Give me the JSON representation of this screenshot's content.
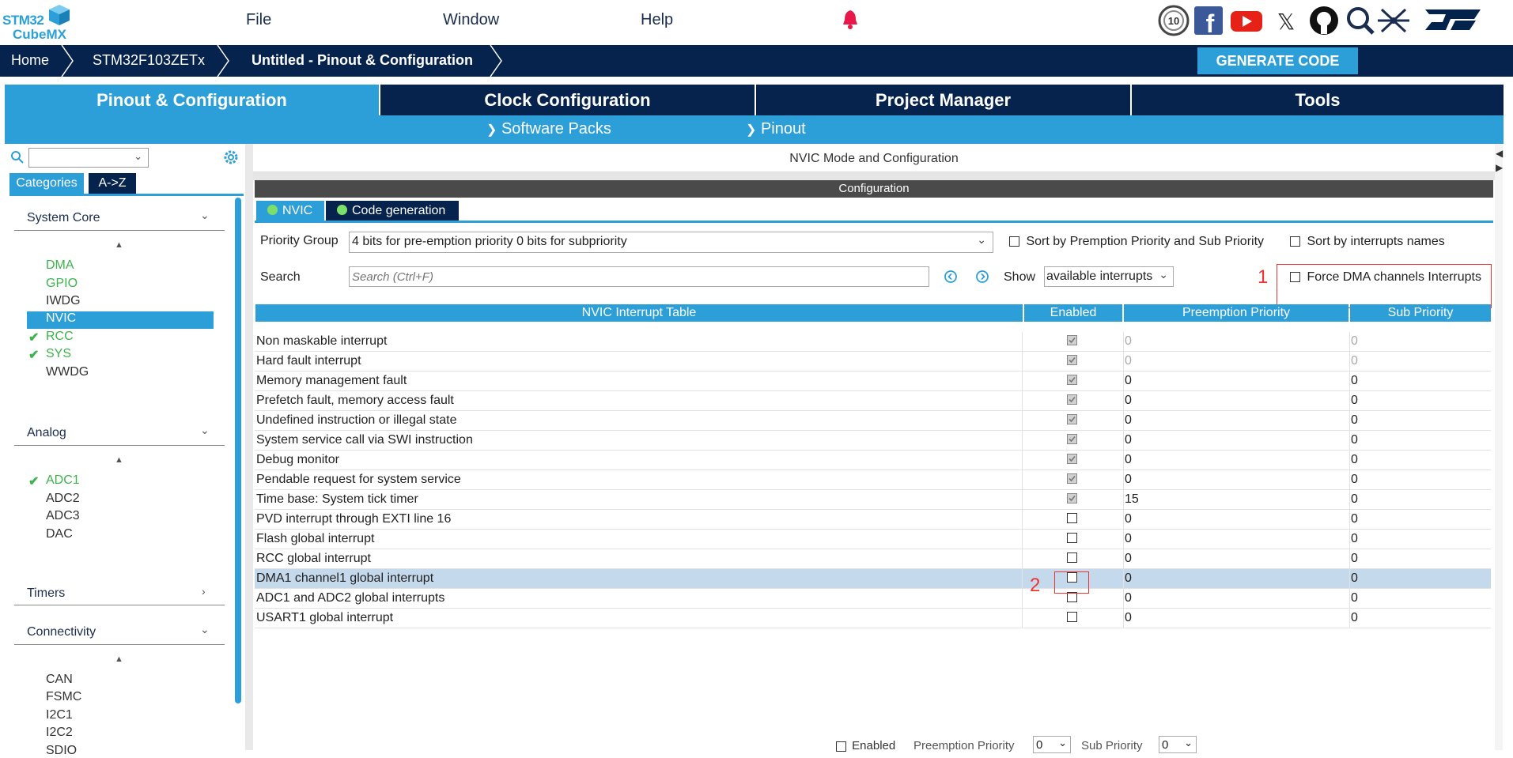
{
  "app": {
    "logo_top": "STM32",
    "logo_bottom": "CubeMX"
  },
  "menu": [
    "File",
    "Window",
    "Help"
  ],
  "breadcrumb": [
    "Home",
    "STM32F103ZETx",
    "Untitled - Pinout & Configuration"
  ],
  "generate_label": "GENERATE CODE",
  "tabs": [
    "Pinout & Configuration",
    "Clock Configuration",
    "Project Manager",
    "Tools"
  ],
  "subtabs": [
    "Software Packs",
    "Pinout"
  ],
  "left": {
    "search_placeholder": "",
    "cat_tabs": [
      "Categories",
      "A->Z"
    ],
    "system_core": {
      "title": "System Core",
      "items": [
        "DMA",
        "GPIO",
        "IWDG",
        "NVIC",
        "RCC",
        "SYS",
        "WWDG"
      ]
    },
    "analog": {
      "title": "Analog",
      "items": [
        "ADC1",
        "ADC2",
        "ADC3",
        "DAC"
      ]
    },
    "timers": {
      "title": "Timers"
    },
    "connectivity": {
      "title": "Connectivity",
      "items": [
        "CAN",
        "FSMC",
        "I2C1",
        "I2C2",
        "SDIO"
      ]
    }
  },
  "main": {
    "header": "NVIC Mode and Configuration",
    "config_title": "Configuration",
    "subtabs": [
      "NVIC",
      "Code generation"
    ],
    "priority_group_label": "Priority Group",
    "priority_group_value": "4 bits for pre-emption priority 0 bits for subpriority",
    "sort_premption": "Sort by Premption Priority and Sub Priority",
    "sort_names": "Sort by interrupts names",
    "search_label": "Search",
    "search_placeholder": "Search (Ctrl+F)",
    "show_label": "Show",
    "show_value": "available interrupts",
    "force_dma": "Force DMA channels Interrupts",
    "annotation_1": "1",
    "annotation_2": "2",
    "table_headers": [
      "NVIC Interrupt Table",
      "Enabled",
      "Preemption Priority",
      "Sub Priority"
    ],
    "rows": [
      {
        "name": "Non maskable interrupt",
        "enabled": true,
        "pp": "0",
        "sp": "0",
        "locked": true
      },
      {
        "name": "Hard fault interrupt",
        "enabled": true,
        "pp": "0",
        "sp": "0",
        "locked": true
      },
      {
        "name": "Memory management fault",
        "enabled": true,
        "pp": "0",
        "sp": "0"
      },
      {
        "name": "Prefetch fault, memory access fault",
        "enabled": true,
        "pp": "0",
        "sp": "0"
      },
      {
        "name": "Undefined instruction or illegal state",
        "enabled": true,
        "pp": "0",
        "sp": "0"
      },
      {
        "name": "System service call via SWI instruction",
        "enabled": true,
        "pp": "0",
        "sp": "0"
      },
      {
        "name": "Debug monitor",
        "enabled": true,
        "pp": "0",
        "sp": "0"
      },
      {
        "name": "Pendable request for system service",
        "enabled": true,
        "pp": "0",
        "sp": "0"
      },
      {
        "name": "Time base: System tick timer",
        "enabled": true,
        "pp": "15",
        "sp": "0"
      },
      {
        "name": "PVD interrupt through EXTI line 16",
        "enabled": false,
        "pp": "0",
        "sp": "0"
      },
      {
        "name": "Flash global interrupt",
        "enabled": false,
        "pp": "0",
        "sp": "0"
      },
      {
        "name": "RCC global interrupt",
        "enabled": false,
        "pp": "0",
        "sp": "0"
      },
      {
        "name": "DMA1 channel1 global interrupt",
        "enabled": false,
        "pp": "0",
        "sp": "0",
        "highlight": true
      },
      {
        "name": "ADC1 and ADC2 global interrupts",
        "enabled": false,
        "pp": "0",
        "sp": "0"
      },
      {
        "name": "USART1 global interrupt",
        "enabled": false,
        "pp": "0",
        "sp": "0"
      }
    ],
    "bottom": {
      "enabled_label": "Enabled",
      "pp_label": "Preemption Priority",
      "pp_value": "0",
      "sp_label": "Sub Priority",
      "sp_value": "0"
    }
  },
  "colors": {
    "navy": "#05234d",
    "blue": "#2d9fd8",
    "green": "#3cb44b",
    "red": "#e33333"
  }
}
